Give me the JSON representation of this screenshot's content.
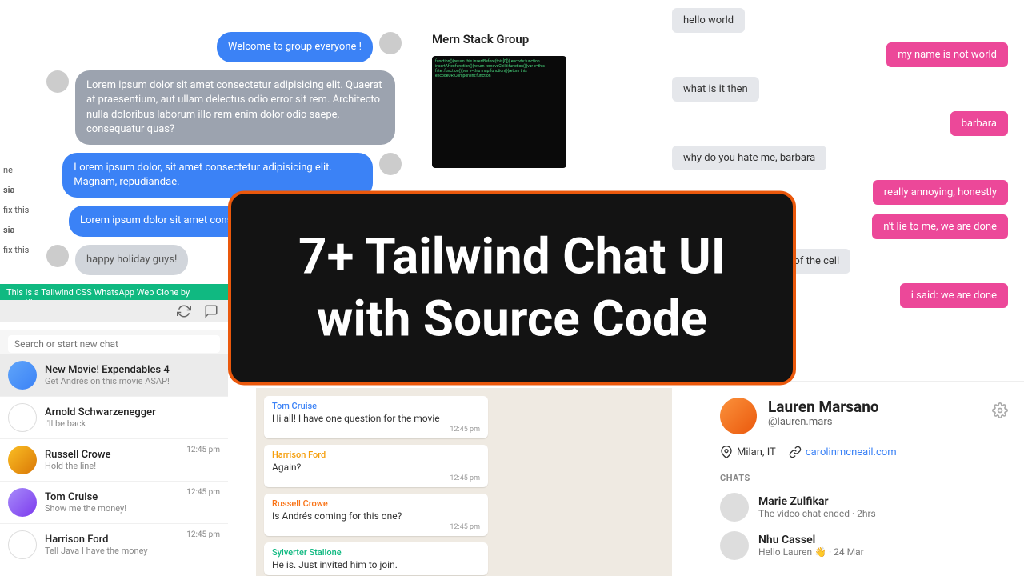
{
  "overlay": {
    "title": "7+ Tailwind Chat UI with Source Code"
  },
  "groupChat": {
    "sidebarTitle": "Mern Stack Group",
    "messages": [
      {
        "side": "right",
        "style": "blue",
        "text": "Welcome to group everyone !",
        "avatar": true
      },
      {
        "side": "left",
        "style": "gray",
        "text": "Lorem ipsum dolor sit amet consectetur adipisicing elit. Quaerat at praesentium, aut ullam delectus odio error sit rem. Architecto nulla doloribus laborum illo rem enim dolor odio saepe, consequatur quas?",
        "avatar": true
      },
      {
        "side": "left",
        "style": "blue",
        "text": "Lorem ipsum dolor, sit amet consectetur adipisicing elit. Magnam, repudiandae.",
        "avatar": true,
        "avatarRight": true
      },
      {
        "side": "left",
        "style": "blue",
        "text": "Lorem ipsum dolor sit amet consectetur a",
        "avatar": false
      },
      {
        "side": "left",
        "style": "lightgray",
        "text": "happy holiday guys!",
        "avatar": true
      }
    ]
  },
  "leftSnippet": {
    "items": [
      "ne",
      "sia",
      "fix this",
      "sia",
      "fix this"
    ]
  },
  "pinkChat": {
    "messages": [
      {
        "side": "left",
        "text": "hello world"
      },
      {
        "side": "right",
        "text": "my name is not world"
      },
      {
        "side": "left",
        "text": "what is it then"
      },
      {
        "side": "right",
        "text": "barbara"
      },
      {
        "side": "left",
        "text": "why do you hate me, barbara"
      },
      {
        "side": "right",
        "text": "really annoying, honestly"
      },
      {
        "side": "right",
        "text": "n't lie to me, we are done"
      },
      {
        "side": "left",
        "text": "must know that the use of the cell"
      },
      {
        "side": "right",
        "text": "i said: we are done"
      }
    ]
  },
  "whatsapp": {
    "banner": "This is a Tailwind CSS WhatsApp Web Clone by asantibanez",
    "searchPlaceholder": "Search or start new chat",
    "contacts": [
      {
        "name": "New Movie! Expendables 4",
        "preview": "Get Andrés on this movie ASAP!",
        "time": "",
        "active": true,
        "avatar": "blue"
      },
      {
        "name": "Arnold Schwarzenegger",
        "preview": "I'll be back",
        "time": "",
        "avatar": "empty"
      },
      {
        "name": "Russell Crowe",
        "preview": "Hold the line!",
        "time": "12:45 pm",
        "avatar": "photo"
      },
      {
        "name": "Tom Cruise",
        "preview": "Show me the money!",
        "time": "12:45 pm",
        "avatar": "photo"
      },
      {
        "name": "Harrison Ford",
        "preview": "Tell Java I have the money",
        "time": "12:45 pm",
        "avatar": "empty"
      }
    ],
    "chatMessages": [
      {
        "sender": "Tom Cruise",
        "color": "#3b82f6",
        "text": "Hi all! I have one question for the movie",
        "time": "12:45 pm"
      },
      {
        "sender": "Harrison Ford",
        "color": "#f59e0b",
        "text": "Again?",
        "time": "12:45 pm"
      },
      {
        "sender": "Russell Crowe",
        "color": "#f97316",
        "text": "Is Andrés coming for this one?",
        "time": "12:45 pm"
      },
      {
        "sender": "Sylverter Stallone",
        "color": "#10b981",
        "text": "He is. Just invited him to join.",
        "time": ""
      }
    ]
  },
  "profile": {
    "name": "Lauren Marsano",
    "handle": "@lauren.mars",
    "location": "Milan, IT",
    "link": "carolinmcneail.com",
    "chatsLabel": "CHATS",
    "chats": [
      {
        "name": "Marie Zulfikar",
        "sub": "The video chat ended · 2hrs"
      },
      {
        "name": "Nhu Cassel",
        "sub": "Hello Lauren 👋 · 24 Mar"
      }
    ]
  }
}
